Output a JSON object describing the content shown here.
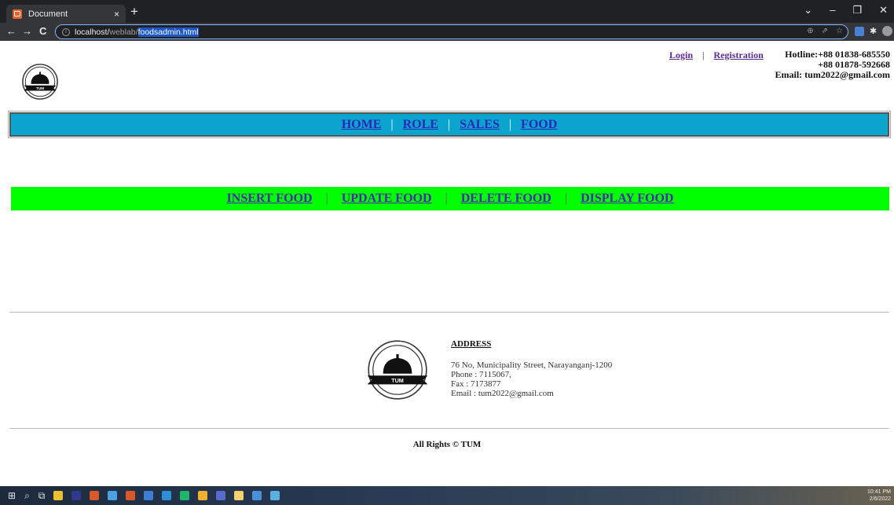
{
  "browser": {
    "tab_title": "Document",
    "tab_close": "×",
    "new_tab": "+",
    "window_controls": [
      "⌄",
      "–",
      "❐",
      "✕"
    ],
    "nav": {
      "back": "←",
      "forward": "→",
      "reload": "C"
    },
    "url_host": "localhost/",
    "url_path": "weblab/",
    "url_selected": "foodsadmin.html",
    "omnibox_icons": [
      "⊕",
      "⇗",
      "☆"
    ]
  },
  "header": {
    "login": "Login",
    "separator": "|",
    "registration": "Registration",
    "hotline_1": "Hotline:+88 01838-685550",
    "hotline_2": "+88 01878-592668",
    "email": "Email: tum2022@gmail.com"
  },
  "logo_text": "TUM",
  "main_nav": {
    "items": [
      "HOME",
      "ROLE",
      "SALES",
      "FOOD"
    ],
    "separator": "|"
  },
  "sub_nav": {
    "items": [
      "INSERT FOOD",
      "UPDATE FOOD",
      "DELETE FOOD",
      "DISPLAY FOOD"
    ],
    "separator": "|"
  },
  "footer": {
    "address_heading": "ADDRESS",
    "address_line": "76 No, Municipality Street, Narayanganj-1200",
    "phone": "Phone : 7115067,",
    "fax": "Fax : 7173877",
    "email": "Email : tum2022@gmail.com",
    "copyright": "All Rights © TUM"
  },
  "taskbar": {
    "time": "10:41 PM",
    "date": "2/6/2022",
    "app_colors": [
      "#e8c030",
      "#2f3a8f",
      "#d9582b",
      "#4aa3e0",
      "#d9582b",
      "#3d7fd6",
      "#2d8fd8",
      "#1fb36b",
      "#f0b030",
      "#5a6bd0",
      "#f2d070",
      "#4a90d9",
      "#5ab0e0"
    ]
  }
}
